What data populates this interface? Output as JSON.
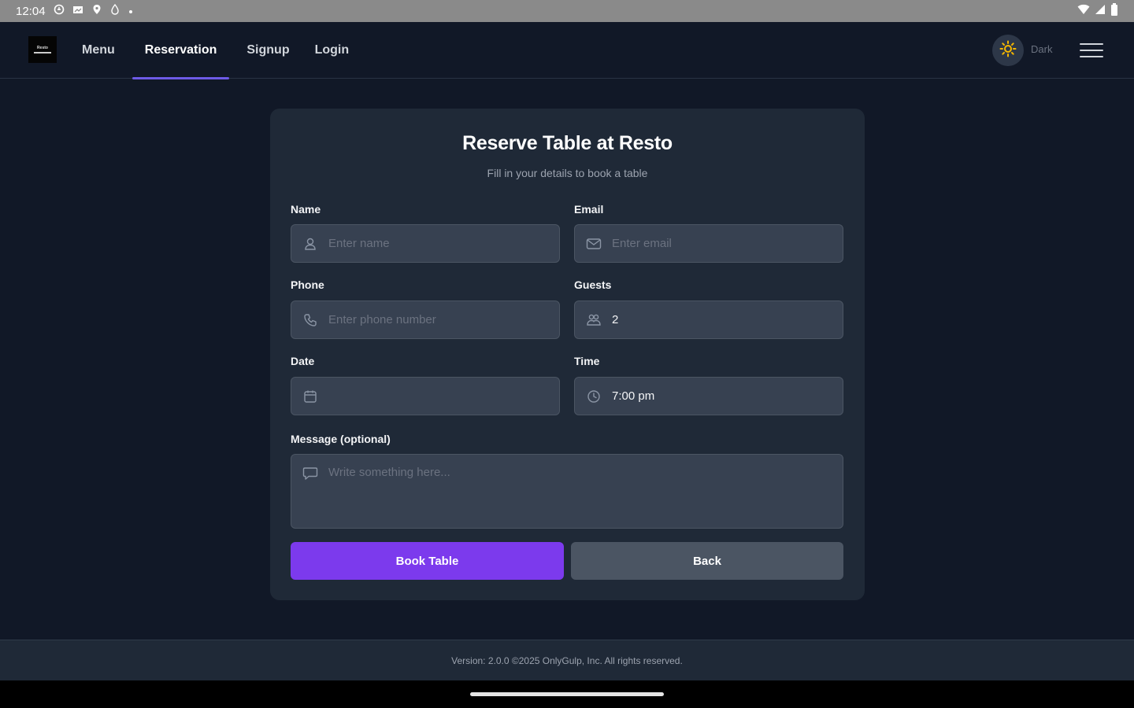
{
  "status_bar": {
    "time": "12:04",
    "icons": [
      "vpn-key-icon",
      "photos-icon",
      "location-icon",
      "drop-icon",
      "dot-icon"
    ],
    "right_icons": [
      "wifi-icon",
      "signal-icon",
      "battery-icon"
    ]
  },
  "navbar": {
    "logo_text": "Resto",
    "links": [
      {
        "label": "Menu",
        "active": false
      },
      {
        "label": "Reservation",
        "active": true
      },
      {
        "label": "Signup",
        "active": false
      },
      {
        "label": "Login",
        "active": false
      }
    ],
    "theme_label": "Dark",
    "theme_icon": "sun-icon",
    "menu_icon": "hamburger-icon"
  },
  "form": {
    "title": "Reserve Table at Resto",
    "subtitle": "Fill in your details to book a table",
    "name": {
      "label": "Name",
      "placeholder": "Enter name",
      "value": "",
      "icon": "user-icon"
    },
    "email": {
      "label": "Email",
      "placeholder": "Enter email",
      "value": "",
      "icon": "mail-icon"
    },
    "phone": {
      "label": "Phone",
      "placeholder": "Enter phone number",
      "value": "",
      "icon": "phone-icon"
    },
    "guests": {
      "label": "Guests",
      "placeholder": "",
      "value": "2",
      "icon": "guests-icon"
    },
    "date": {
      "label": "Date",
      "placeholder": "",
      "value": "",
      "icon": "calendar-icon"
    },
    "time": {
      "label": "Time",
      "placeholder": "",
      "value": "7:00 pm",
      "icon": "clock-icon"
    },
    "message": {
      "label": "Message (optional)",
      "placeholder": "Write something here...",
      "value": "",
      "icon": "chat-icon"
    },
    "submit_label": "Book Table",
    "back_label": "Back"
  },
  "footer": {
    "text": "Version: 2.0.0 ©2025 OnlyGulp, Inc. All rights reserved."
  },
  "colors": {
    "page_bg": "#111827",
    "card_bg": "#1f2937",
    "input_bg": "#374151",
    "accent": "#7c3aed",
    "nav_indicator": "#6d5ae6",
    "sun": "#f5b700"
  }
}
